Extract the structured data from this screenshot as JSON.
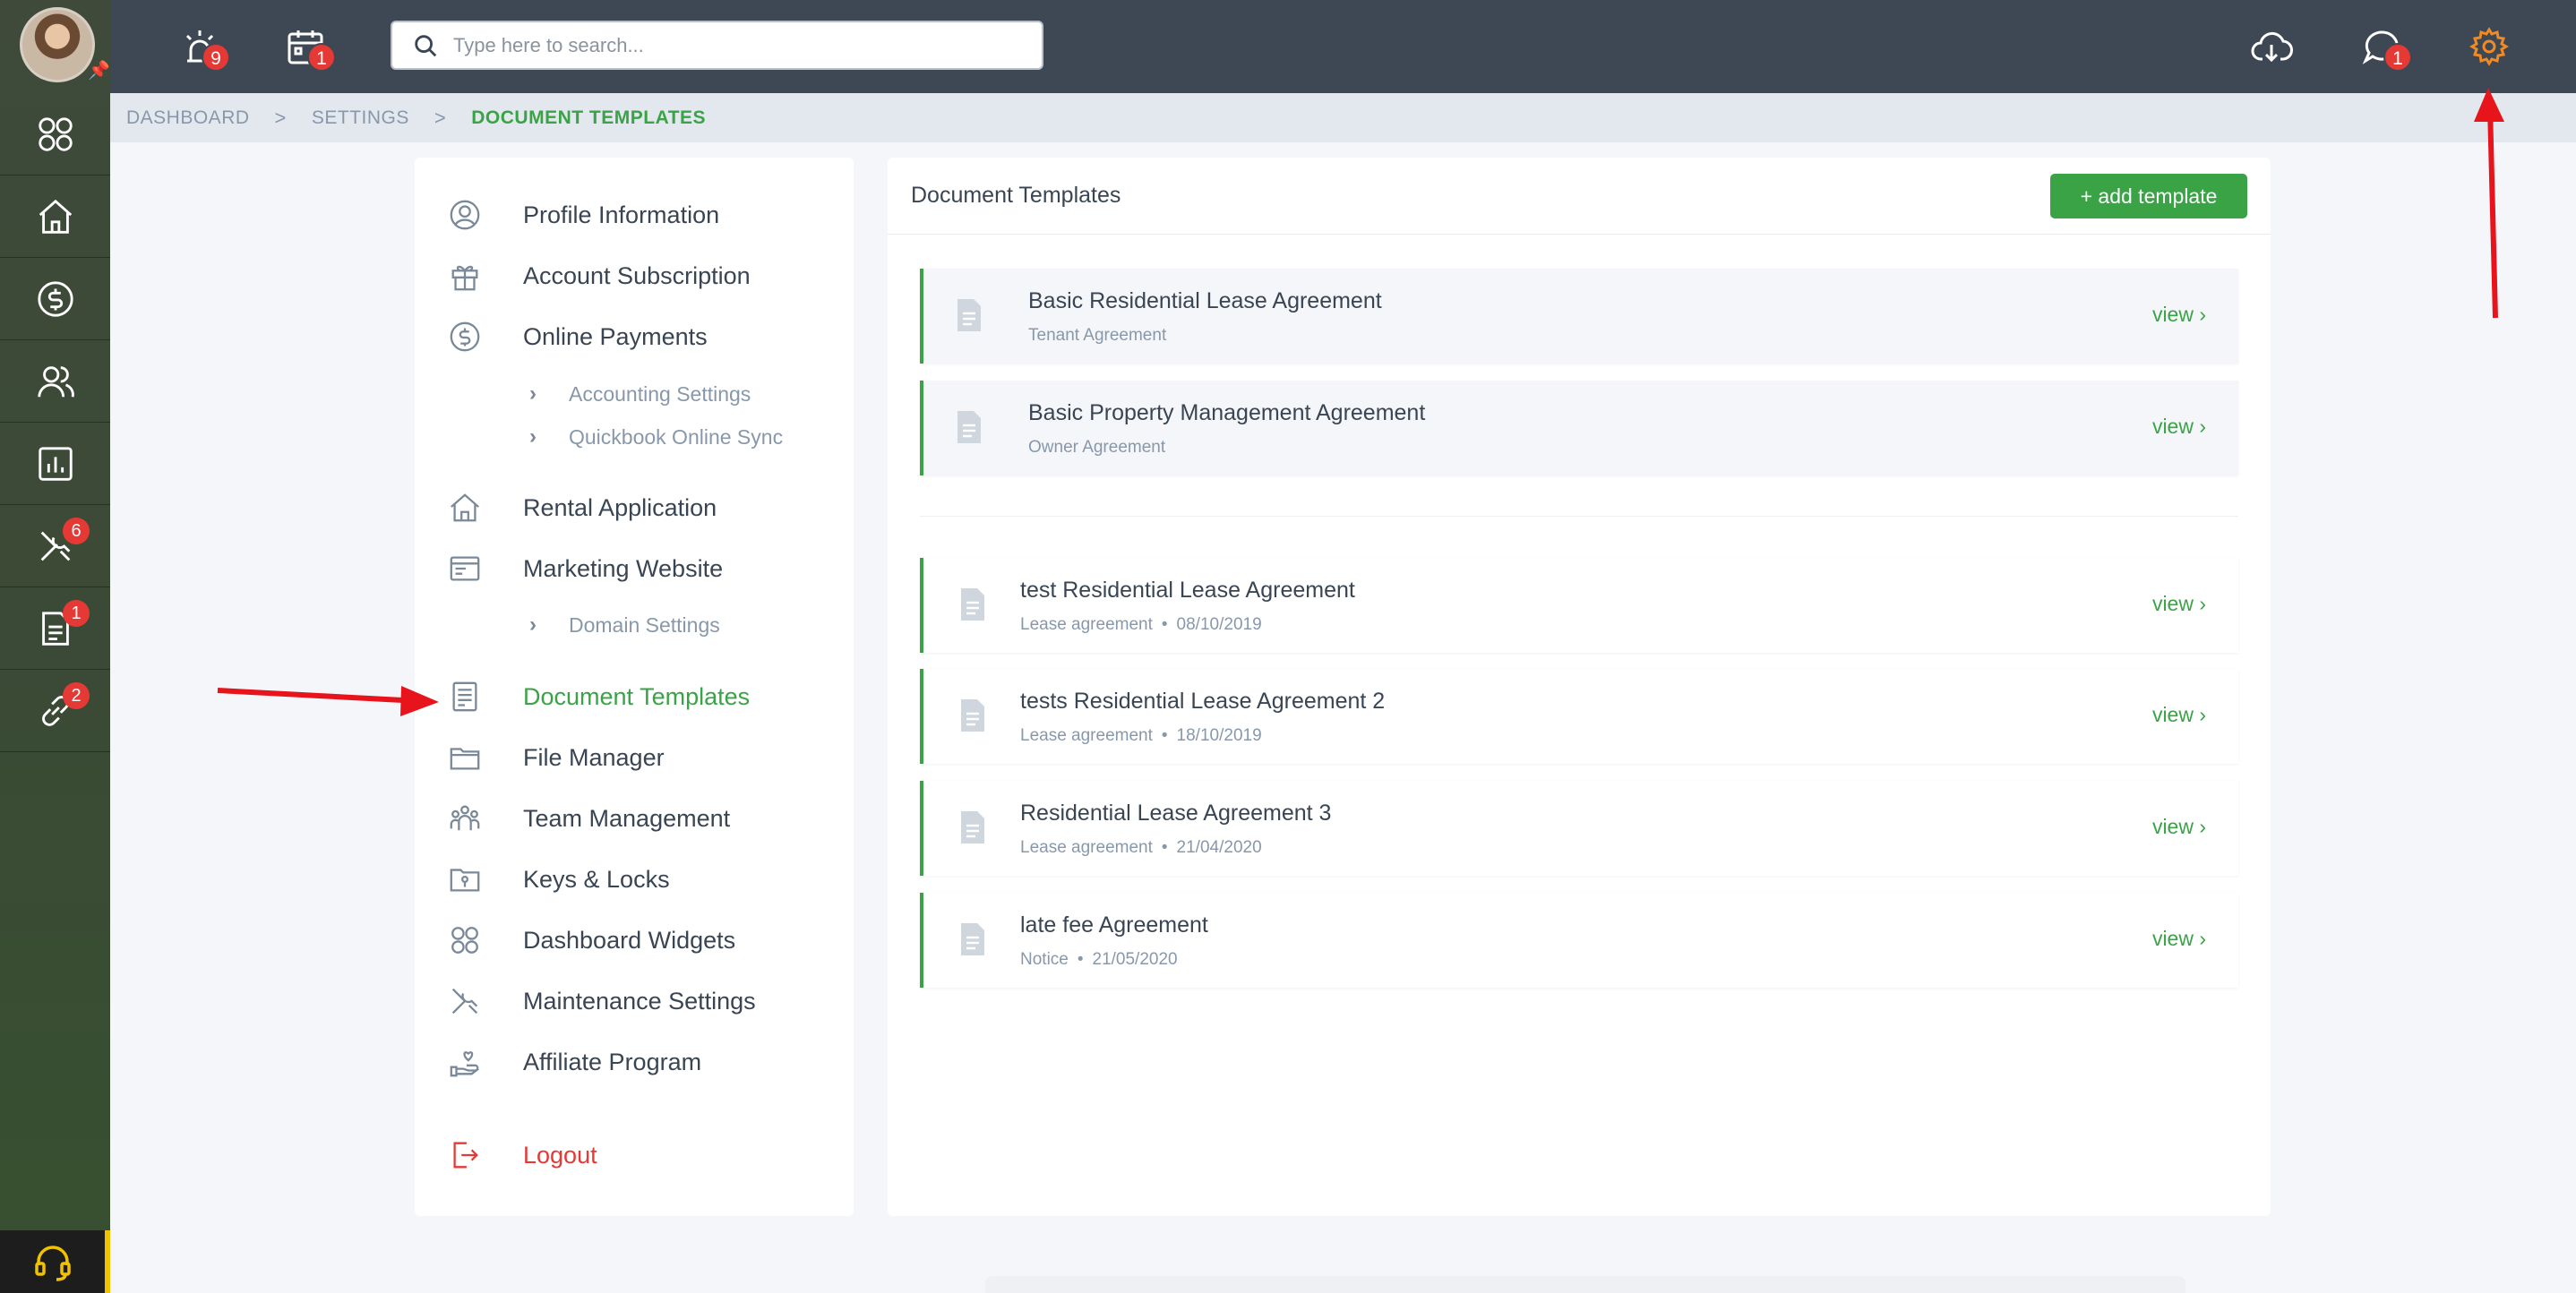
{
  "topbar": {
    "alerts_badge": "9",
    "calendar_badge": "1",
    "messages_badge": "1",
    "search_placeholder": "Type here to search..."
  },
  "rail": {
    "maintenance_badge": "6",
    "documents_badge": "1",
    "links_badge": "2"
  },
  "breadcrumb": {
    "items": [
      "DASHBOARD",
      "SETTINGS",
      "DOCUMENT TEMPLATES"
    ],
    "separator": ">"
  },
  "settings_menu": {
    "items": [
      {
        "label": "Profile Information",
        "icon": "user-circle-icon"
      },
      {
        "label": "Account Subscription",
        "icon": "gift-icon"
      },
      {
        "label": "Online Payments",
        "icon": "dollar-circle-icon"
      },
      {
        "label": "Rental Application",
        "icon": "home-icon"
      },
      {
        "label": "Marketing Website",
        "icon": "browser-icon"
      },
      {
        "label": "Document Templates",
        "icon": "document-list-icon"
      },
      {
        "label": "File Manager",
        "icon": "folder-icon"
      },
      {
        "label": "Team Management",
        "icon": "team-icon"
      },
      {
        "label": "Keys & Locks",
        "icon": "key-folder-icon"
      },
      {
        "label": "Dashboard Widgets",
        "icon": "widgets-icon"
      },
      {
        "label": "Maintenance Settings",
        "icon": "tools-icon"
      },
      {
        "label": "Affiliate Program",
        "icon": "hand-heart-icon"
      }
    ],
    "sub_items": {
      "accounting": "Accounting Settings",
      "quickbook": "Quickbook Online Sync",
      "domain": "Domain Settings"
    },
    "logout": "Logout",
    "active": "Document Templates"
  },
  "content": {
    "title": "Document Templates",
    "add_button": "+ add template",
    "view_label": "view ›",
    "default_templates": [
      {
        "title": "Basic Residential Lease Agreement",
        "type": "Tenant Agreement"
      },
      {
        "title": "Basic Property Management Agreement",
        "type": "Owner Agreement"
      }
    ],
    "custom_templates": [
      {
        "title": "test Residential Lease Agreement",
        "type": "Lease agreement",
        "date": "08/10/2019"
      },
      {
        "title": "tests Residential Lease Agreement 2",
        "type": "Lease agreement",
        "date": "18/10/2019"
      },
      {
        "title": "Residential Lease Agreement 3",
        "type": "Lease agreement",
        "date": "21/04/2020"
      },
      {
        "title": "late fee Agreement",
        "type": "Notice",
        "date": "21/05/2020"
      }
    ]
  },
  "colors": {
    "accent_green": "#3aa346",
    "badge_red": "#e53935",
    "topbar": "#3e4855",
    "settings_icon_orange": "#f08a24",
    "annotation_red": "#e8141b"
  }
}
